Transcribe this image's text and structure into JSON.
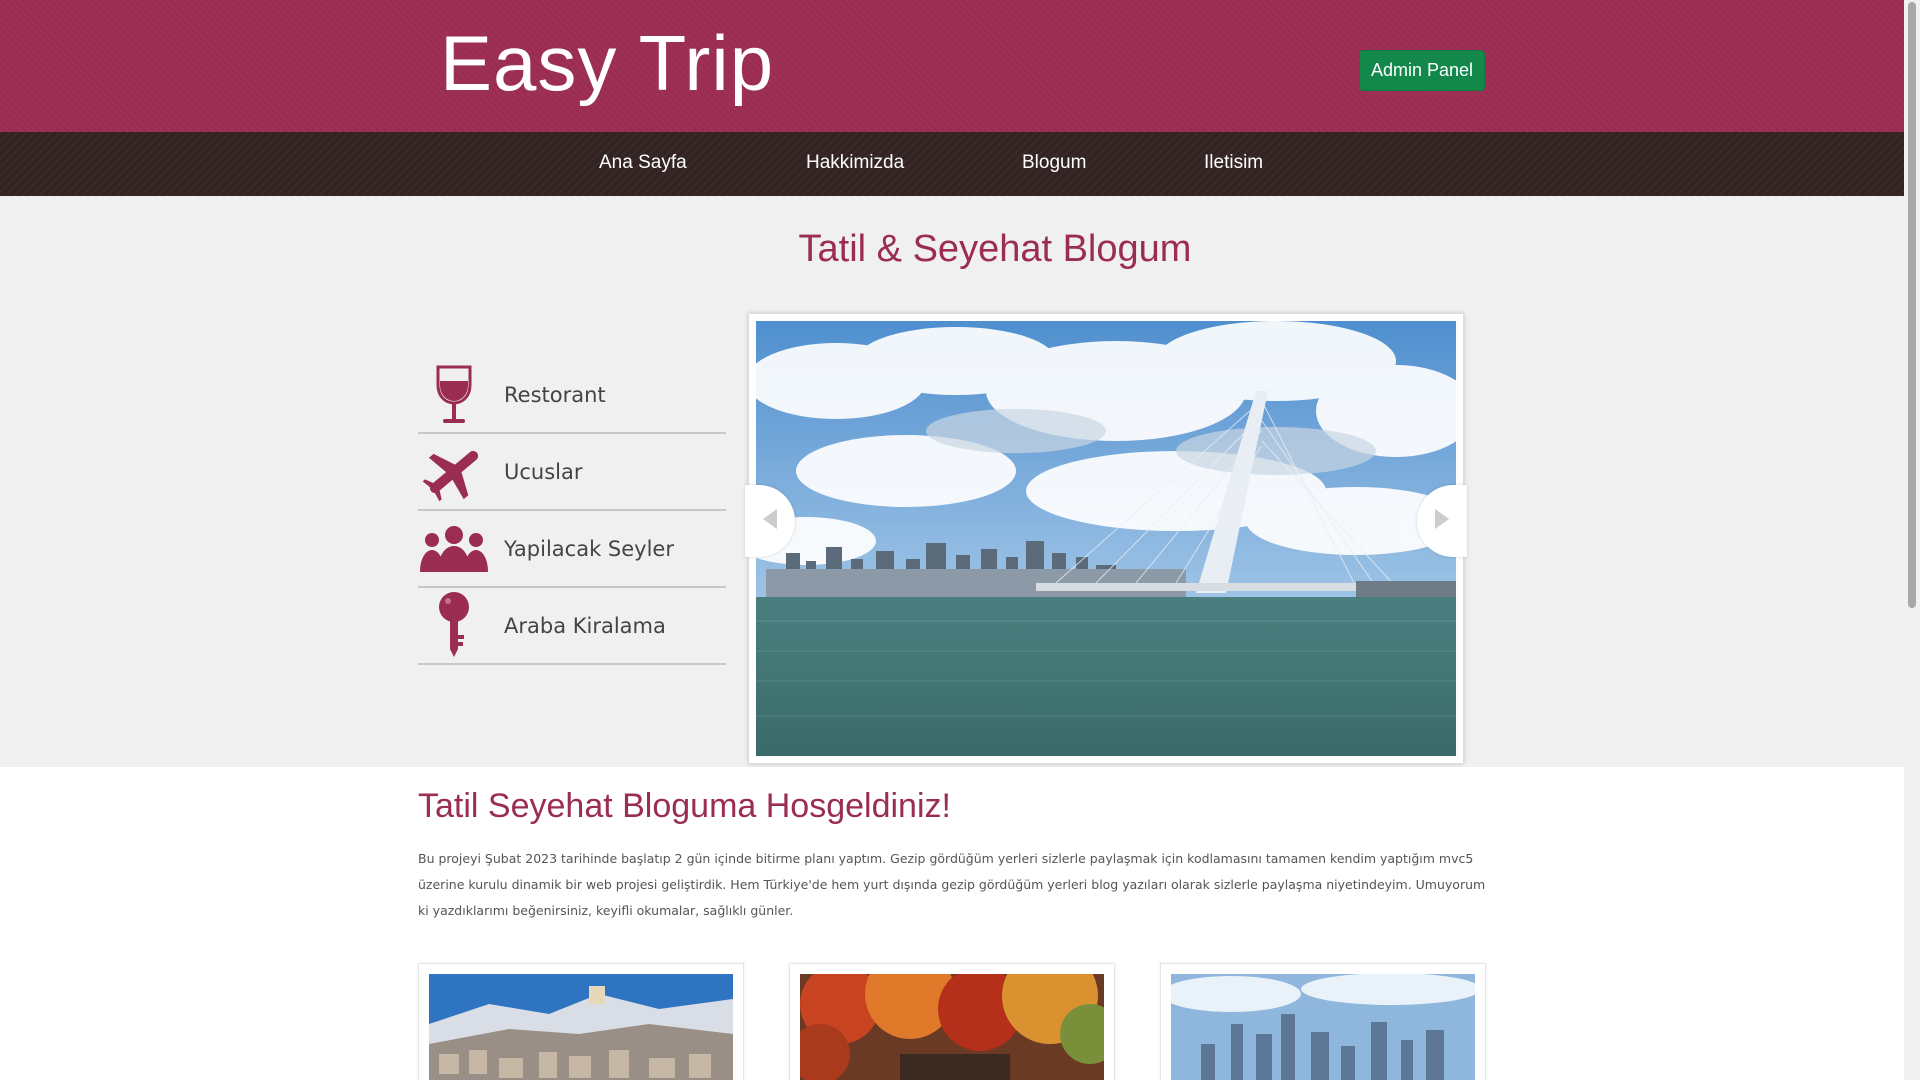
{
  "header": {
    "logo": "Easy Trip",
    "admin_button": "Admin Panel"
  },
  "nav": {
    "items": [
      "Ana Sayfa",
      "Hakkimizda",
      "Blogum",
      "Iletisim"
    ]
  },
  "hero": {
    "title": "Tatil & Seyehat Blogum",
    "categories": [
      {
        "label": "Restorant",
        "icon": "wine-glass-icon"
      },
      {
        "label": "Ucuslar",
        "icon": "airplane-icon"
      },
      {
        "label": "Yapilacak Seyler",
        "icon": "people-icon"
      },
      {
        "label": "Araba Kiralama",
        "icon": "key-icon"
      }
    ]
  },
  "welcome": {
    "title": "Tatil Seyehat Bloguma Hosgeldiniz!",
    "text": "Bu projeyi Şubat 2023 tarihinde başlatıp 2 gün içinde bitirme planı yaptım. Gezip gördüğüm yerleri sizlerle paylaşmak için kodlamasını tamamen kendim yaptığım mvc5 üzerine kurulu dinamik bir web projesi geliştirdik. Hem Türkiye'de hem yurt dışında gezip gördüğüm yerleri blog yazıları olarak sizlerle paylaşma niyetindeyim. Umuyorum ki yazdıklarımı beğenirsiniz, keyifli okumalar, sağlıklı günler."
  },
  "colors": {
    "brand": "#9b2c52",
    "nav_bg": "#332323",
    "admin_button": "#12894a"
  }
}
